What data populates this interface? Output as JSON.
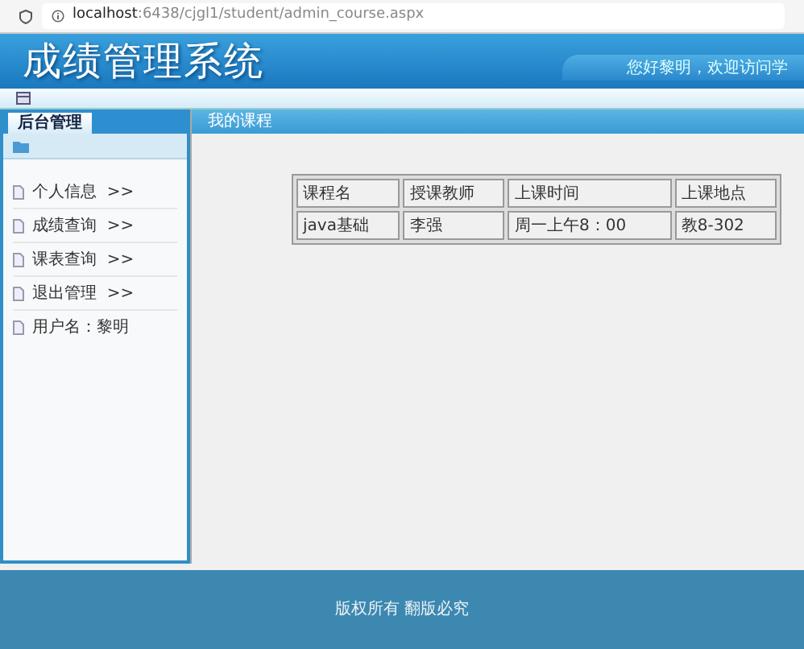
{
  "browser": {
    "url_host": "localhost",
    "url_rest": ":6438/cjgl1/student/admin_course.aspx"
  },
  "header": {
    "title": "成绩管理系统",
    "welcome": "您好黎明，欢迎访问学"
  },
  "sidebar": {
    "tab": "后台管理",
    "items": [
      {
        "label": "个人信息",
        "arrow": ">>"
      },
      {
        "label": "成绩查询",
        "arrow": ">>"
      },
      {
        "label": "课表查询",
        "arrow": ">>"
      },
      {
        "label": "退出管理",
        "arrow": ">>"
      },
      {
        "label": "用户名：黎明"
      }
    ]
  },
  "content": {
    "title": "我的课程",
    "table": {
      "columns": [
        "课程名",
        "授课教师",
        "上课时间",
        "上课地点"
      ],
      "rows": [
        [
          "java基础",
          "李强",
          "周一上午8：00",
          "教8-302"
        ]
      ]
    }
  },
  "footer": {
    "text": "版权所有 翻版必究"
  }
}
